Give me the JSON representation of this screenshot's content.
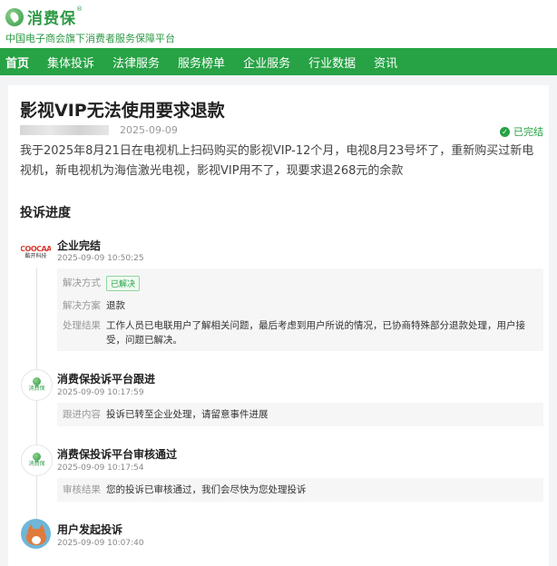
{
  "header": {
    "logo_text": "消费保",
    "logo_reg": "®",
    "tagline": "中国电子商会旗下消费者服务保障平台"
  },
  "nav": {
    "items": [
      "首页",
      "集体投诉",
      "法律服务",
      "服务榜单",
      "企业服务",
      "行业数据",
      "资讯"
    ]
  },
  "complaint": {
    "title": "影视VIP无法使用要求退款",
    "date": "2025-09-09",
    "status": "已完结",
    "description": "我于2025年8月21日在电视机上扫码购买的影视VIP-12个月，电视8月23号坏了，重新购买过新电视机，新电视机为海信激光电视，影视VIP用不了，现要求退268元的余款"
  },
  "progress": {
    "section_title": "投诉进度",
    "company_logo_top": "COOCAA",
    "company_logo_bottom": "酷开科技",
    "platform_logo": "消费保",
    "steps": [
      {
        "title": "企业完结",
        "time": "2025-09-09 10:50:25",
        "rows": [
          {
            "label": "解决方式",
            "value": "已解决"
          },
          {
            "label": "解决方案",
            "value": "退款"
          },
          {
            "label": "处理结果",
            "value": "工作人员已电联用户了解相关问题，最后考虑到用户所说的情况，已协商特殊部分退款处理，用户接受，问题已解决。"
          }
        ]
      },
      {
        "title": "消费保投诉平台跟进",
        "time": "2025-09-09 10:17:59",
        "rows": [
          {
            "label": "跟进内容",
            "value": "投诉已转至企业处理，请留意事件进展"
          }
        ]
      },
      {
        "title": "消费保投诉平台审核通过",
        "time": "2025-09-09 10:17:54",
        "rows": [
          {
            "label": "审核结果",
            "value": "您的投诉已审核通过，我们会尽快为您处理投诉"
          }
        ]
      },
      {
        "title": "用户发起投诉",
        "time": "2025-09-09 10:07:40"
      }
    ]
  },
  "colors": {
    "brand_green": "#27a245",
    "page_bg": "#f3f4f6"
  }
}
